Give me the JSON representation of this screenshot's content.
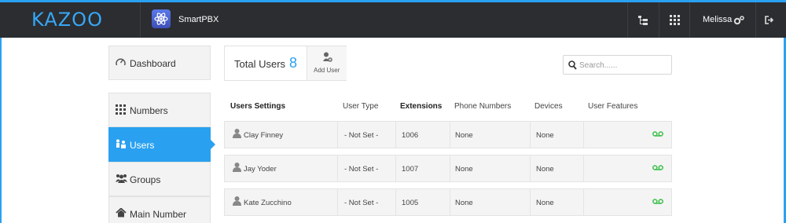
{
  "topbar": {
    "logo": "KAZOO",
    "app_name": "SmartPBX",
    "user_name": "Melissa",
    "icons": [
      "sitemap-icon",
      "apps-grid-icon",
      "settings-gear-icon",
      "logout-icon"
    ]
  },
  "sidebar": {
    "items": [
      {
        "label": "Dashboard",
        "icon": "dashboard-icon"
      },
      {
        "label": "Numbers",
        "icon": "numbers-grid-icon"
      },
      {
        "label": "Users",
        "icon": "users-icon",
        "active": true
      },
      {
        "label": "Groups",
        "icon": "groups-icon"
      },
      {
        "label": "Main Number",
        "icon": "home-icon"
      }
    ]
  },
  "summary": {
    "total_label": "Total Users",
    "total_count": "8",
    "add_user_label": "Add User"
  },
  "search": {
    "placeholder": "Search......"
  },
  "table": {
    "headers": [
      "Users Settings",
      "User Type",
      "Extensions",
      "Phone Numbers",
      "Devices",
      "User Features"
    ],
    "rows": [
      {
        "name": "Clay Finney",
        "type": "- Not Set -",
        "extension": "1006",
        "phone": "None",
        "devices": "None",
        "feature": "voicemail-icon"
      },
      {
        "name": "Jay Yoder",
        "type": "- Not Set -",
        "extension": "1007",
        "phone": "None",
        "devices": "None",
        "feature": "voicemail-icon"
      },
      {
        "name": "Kate Zucchino",
        "type": "- Not Set -",
        "extension": "1005",
        "phone": "None",
        "devices": "None",
        "feature": "voicemail-icon"
      }
    ]
  },
  "colors": {
    "accent": "#2aa1f0",
    "topbar": "#2b2d31",
    "voicemail": "#3cbf4a"
  }
}
